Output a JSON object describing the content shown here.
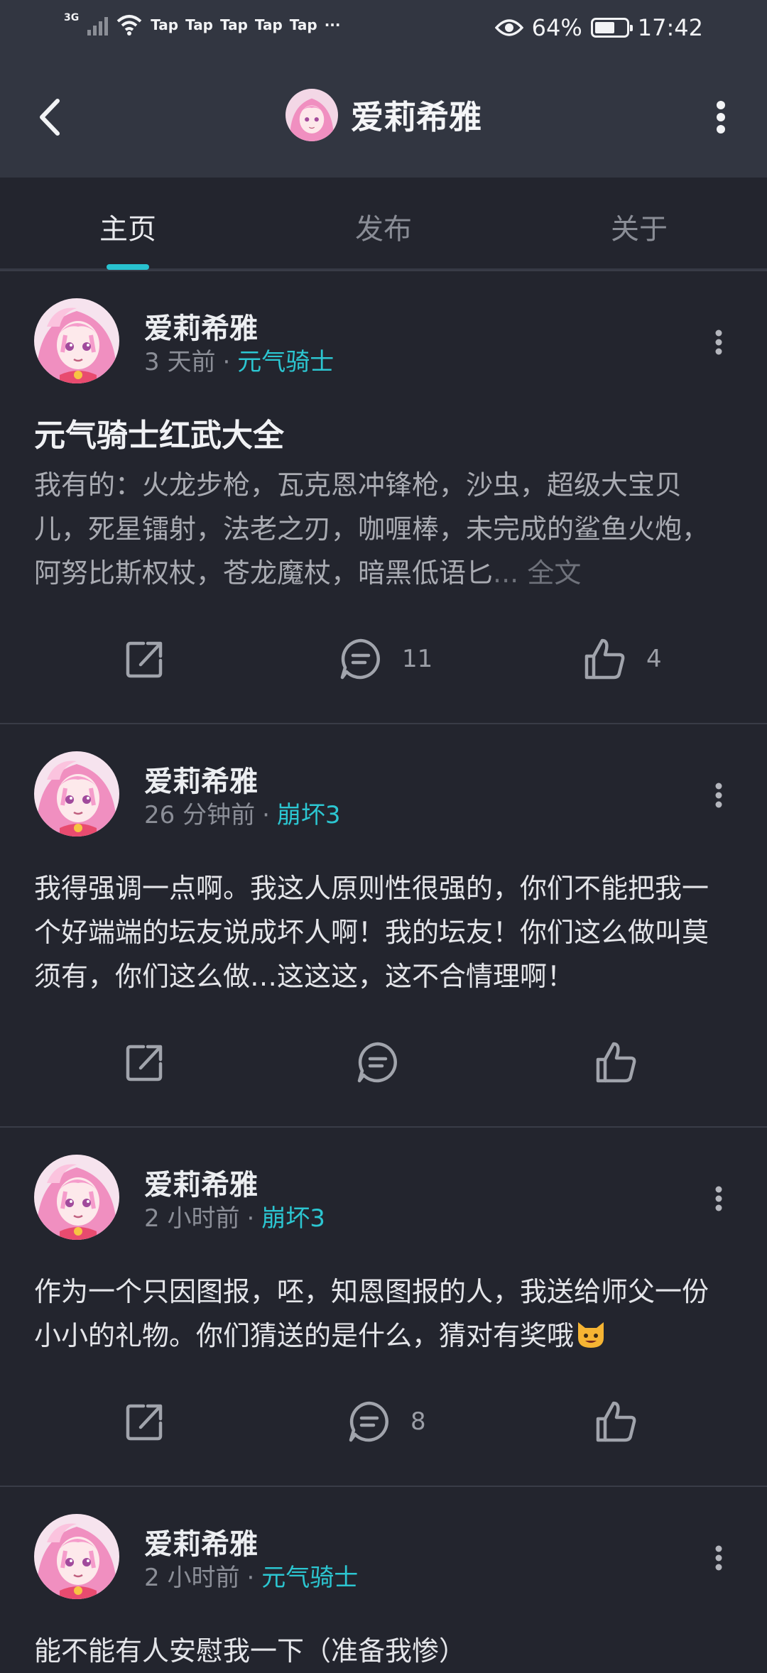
{
  "status_bar": {
    "network": "3G",
    "apps": [
      "Tap",
      "Tap",
      "Tap",
      "Tap",
      "Tap"
    ],
    "more": "···",
    "battery": "64%",
    "battery_level": 0.64,
    "time": "17:42"
  },
  "header": {
    "title": "爱莉希雅"
  },
  "tabs": {
    "items": [
      {
        "label": "主页"
      },
      {
        "label": "发布"
      },
      {
        "label": "关于"
      }
    ],
    "active": "主页"
  },
  "posts": [
    {
      "author": "爱莉希雅",
      "time": "3 天前",
      "tag": "元气骑士",
      "title": "元气骑士红武大全",
      "body": "我有的：火龙步枪，瓦克恩冲锋枪，沙虫，超级大宝贝儿，死星镭射，法老之刃，咖喱棒，未完成的鲨鱼火炮，阿努比斯权杖，苍龙魔杖，暗黑低语匕",
      "ellipsis": "...",
      "full_text": "全文",
      "comments": "11",
      "likes": "4"
    },
    {
      "author": "爱莉希雅",
      "time": "26 分钟前",
      "tag": "崩坏3",
      "body": "我得强调一点啊。我这人原则性很强的，你们不能把我一个好端端的坛友说成坏人啊！我的坛友！你们这么做叫莫须有，你们这么做…这这这，这不合情理啊！",
      "comments": "",
      "likes": ""
    },
    {
      "author": "爱莉希雅",
      "time": "2 小时前",
      "tag": "崩坏3",
      "body": "作为一个只因图报，呸，知恩图报的人，我送给师父一份小小的礼物。你们猜送的是什么，猜对有奖哦",
      "comments": "8",
      "likes": ""
    },
    {
      "author": "爱莉希雅",
      "time": "2 小时前",
      "tag": "元气骑士",
      "body": "能不能有人安慰我一下（准备我惨）",
      "comments": "",
      "likes": ""
    }
  ],
  "meta_separator": "·",
  "colors": {
    "accent": "#28c2cf",
    "background": "#23252e",
    "header": "#323641"
  }
}
